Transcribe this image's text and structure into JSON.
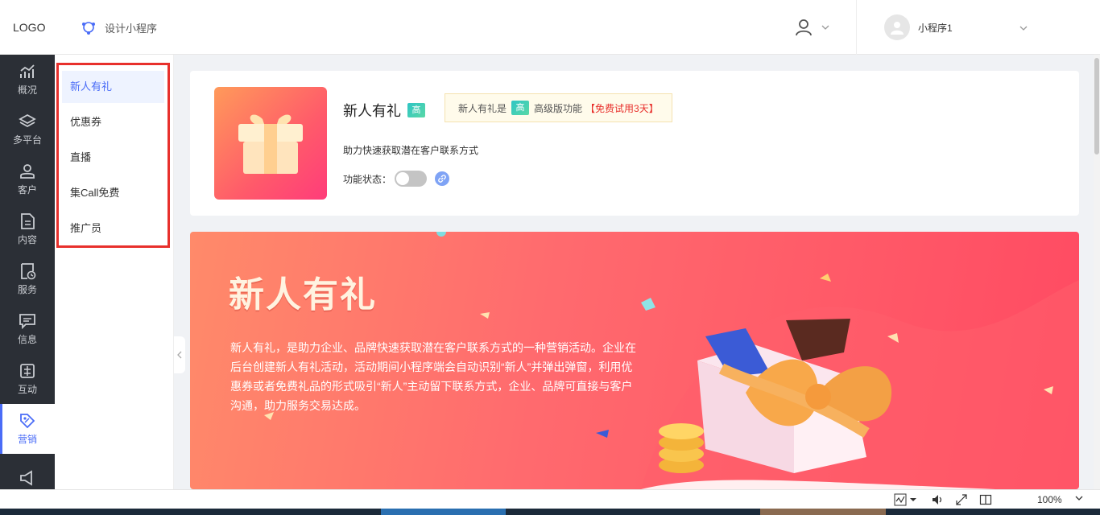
{
  "header": {
    "logo": "LOGO",
    "design_link": "设计小程序",
    "account_name": "小程序1"
  },
  "leftnav": {
    "items": [
      {
        "label": "概况",
        "icon": "chart-trend-icon"
      },
      {
        "label": "多平台",
        "icon": "layers-icon"
      },
      {
        "label": "客户",
        "icon": "user-icon"
      },
      {
        "label": "内容",
        "icon": "document-icon"
      },
      {
        "label": "服务",
        "icon": "service-clock-icon"
      },
      {
        "label": "信息",
        "icon": "message-icon"
      },
      {
        "label": "互动",
        "icon": "interaction-icon"
      },
      {
        "label": "营销",
        "icon": "tag-icon",
        "active": true
      }
    ]
  },
  "submenu": {
    "items": [
      "新人有礼",
      "优惠券",
      "直播",
      "集Call免费",
      "推广员"
    ],
    "active_index": 0
  },
  "card": {
    "title": "新人有礼",
    "badge": "高",
    "notice_prefix": "新人有礼是",
    "notice_suffix": "高级版功能",
    "notice_trial": "【免费试用3天】",
    "description": "助力快速获取潜在客户联系方式",
    "status_label": "功能状态：",
    "status_on": false
  },
  "banner": {
    "title": "新人有礼",
    "text": "新人有礼，是助力企业、品牌快速获取潜在客户联系方式的一种营销活动。企业在后台创建新人有礼活动，活动期间小程序端会自动识别“新人”并弹出弹窗，利用优惠券或者免费礼品的形式吸引“新人”主动留下联系方式，企业、品牌可直接与客户沟通，助力服务交易达成。"
  },
  "statusbar": {
    "zoom": "100%"
  },
  "colors": {
    "accent": "#4a6cf7",
    "nav_bg": "#2b2f36",
    "highlight_border": "#e8302c",
    "trial_red": "#e8302c"
  }
}
